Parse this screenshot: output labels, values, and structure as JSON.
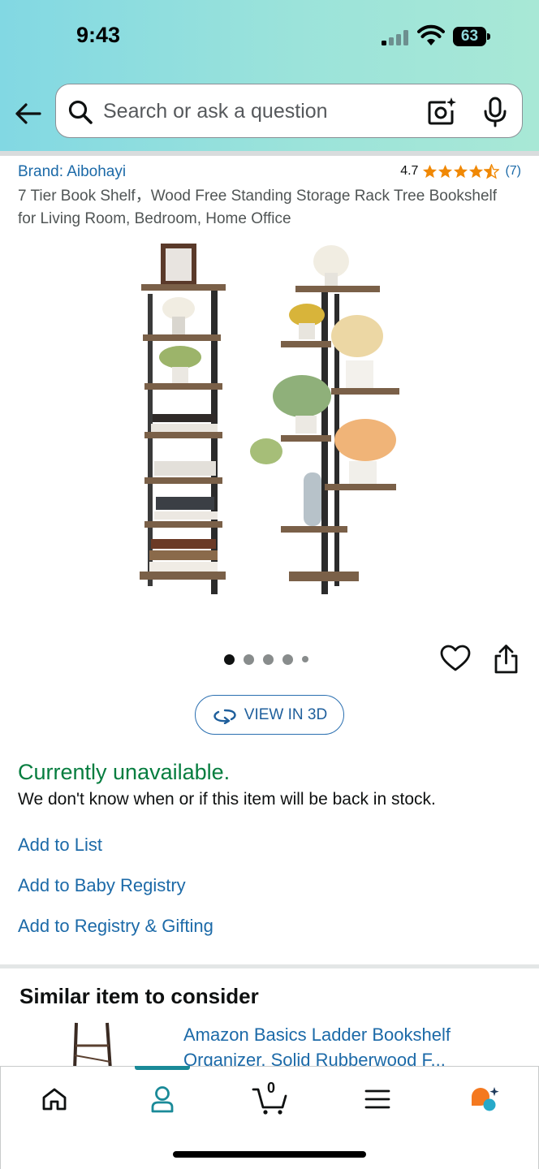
{
  "status_bar": {
    "time": "9:43",
    "battery": "63"
  },
  "search": {
    "placeholder": "Search or ask a question"
  },
  "product": {
    "brand": "Brand: Aibohayi",
    "rating": "4.7",
    "rating_stars": 4.7,
    "rating_count": "(7)",
    "title": "7 Tier Book Shelf，Wood Free Standing Storage Rack Tree Bookshelf for Living Room, Bedroom, Home Office",
    "image_count": 5,
    "active_image": 1,
    "view_3d_label": "VIEW IN 3D"
  },
  "availability": {
    "status": "Currently unavailable.",
    "message": "We don't know when or if this item will be back in stock."
  },
  "actions": {
    "add_to_list": "Add to List",
    "add_to_baby_registry": "Add to Baby Registry",
    "add_to_registry_gifting": "Add to Registry & Gifting"
  },
  "similar": {
    "heading": "Similar item to consider",
    "title": "Amazon Basics Ladder Bookshelf Organizer, Solid Rubberwood F..."
  },
  "bottom_nav": {
    "cart_count": "0",
    "active_tab": "account",
    "items": [
      "home-icon",
      "account-icon",
      "cart-icon",
      "menu-icon",
      "rufus-icon"
    ]
  },
  "colors": {
    "link": "#1c6aa8",
    "available_green": "#067d3f",
    "star": "#f08804",
    "nav_accent": "#1a8a98"
  }
}
